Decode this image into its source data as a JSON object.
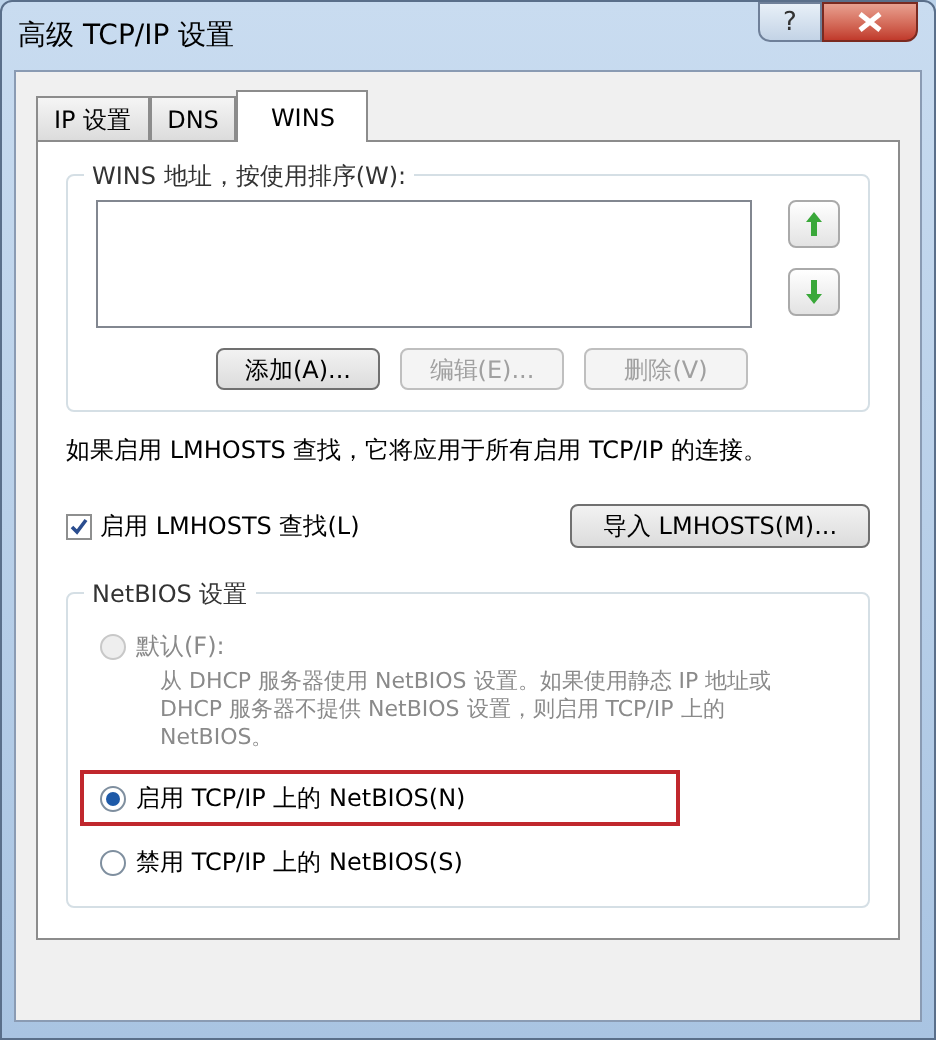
{
  "window": {
    "title": "高级 TCP/IP 设置",
    "help": "?"
  },
  "tabs": [
    {
      "label": "IP 设置",
      "selected": false
    },
    {
      "label": "DNS",
      "selected": false
    },
    {
      "label": "WINS",
      "selected": true
    }
  ],
  "wins_group": {
    "label": "WINS 地址，按使用排序(W):",
    "buttons": [
      {
        "label": "添加(A)...",
        "disabled": false
      },
      {
        "label": "编辑(E)...",
        "disabled": true
      },
      {
        "label": "删除(V)",
        "disabled": true
      }
    ]
  },
  "lmhosts": {
    "note": "如果启用 LMHOSTS 查找，它将应用于所有启用 TCP/IP 的连接。",
    "checkbox": {
      "label": "启用 LMHOSTS 查找(L)",
      "checked": true
    },
    "import_button": "导入 LMHOSTS(M)..."
  },
  "netbios": {
    "label": "NetBIOS 设置",
    "options": [
      {
        "label": "默认(F):",
        "selected": false,
        "disabled": true,
        "highlighted": false,
        "description": "从 DHCP 服务器使用 NetBIOS 设置。如果使用静态 IP 地址或 DHCP 服务器不提供 NetBIOS 设置，则启用 TCP/IP 上的 NetBIOS。"
      },
      {
        "label": "启用 TCP/IP 上的 NetBIOS(N)",
        "selected": true,
        "disabled": false,
        "highlighted": true
      },
      {
        "label": "禁用 TCP/IP 上的 NetBIOS(S)",
        "selected": false,
        "disabled": false,
        "highlighted": false
      }
    ]
  }
}
